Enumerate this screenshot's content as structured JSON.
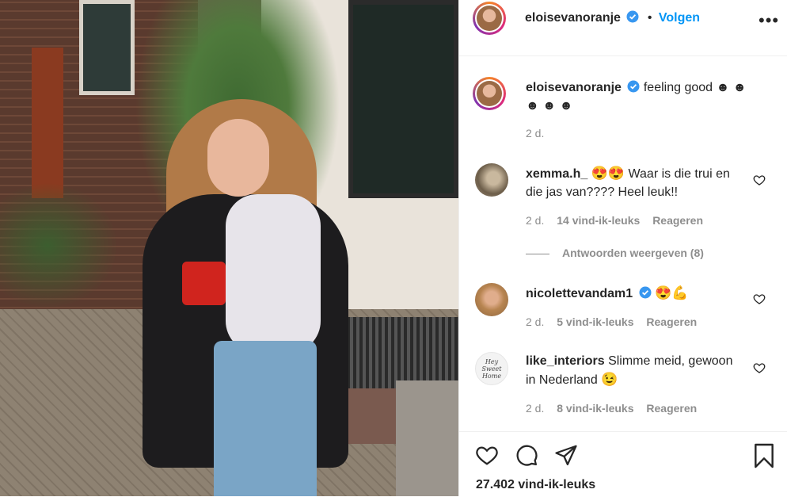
{
  "post_author": {
    "username": "eloisevanoranje",
    "follow_label": "Volgen",
    "dot": "•"
  },
  "caption": {
    "username": "eloisevanoranje",
    "text": "feeling good ☻ ☻ ☻ ☻ ☻",
    "time": "2 d."
  },
  "comments": [
    {
      "username": "xemma.h_",
      "emoji": "😍😍",
      "text": "Waar is die trui en die jas van???? Heel leuk!!",
      "time": "2 d.",
      "likes": "14 vind-ik-leuks",
      "reply_label": "Reageren"
    },
    {
      "username": "nicolettevandam1",
      "emoji": "😍💪",
      "text": "",
      "time": "2 d.",
      "likes": "5 vind-ik-leuks",
      "reply_label": "Reageren"
    },
    {
      "username": "like_interiors",
      "emoji": "😉",
      "text": "Slimme meid, gewoon in Nederland",
      "time": "2 d.",
      "likes": "8 vind-ik-leuks",
      "reply_label": "Reageren"
    }
  ],
  "view_replies_label": "Antwoorden weergeven (8)",
  "like_count": "27.402 vind-ik-leuks",
  "avatar_text": "Hey Sweet Home",
  "icons": {
    "more": "more-options-icon",
    "verified": "verified-badge-icon",
    "comment_like": "heart-outline-icon",
    "like": "heart-icon",
    "comment": "comment-icon",
    "share": "share-icon",
    "save": "bookmark-icon"
  },
  "colors": {
    "accent": "#0095f6",
    "verified": "#3897f0",
    "text": "#262626",
    "muted": "#8e8e8e",
    "border": "#efefef"
  }
}
